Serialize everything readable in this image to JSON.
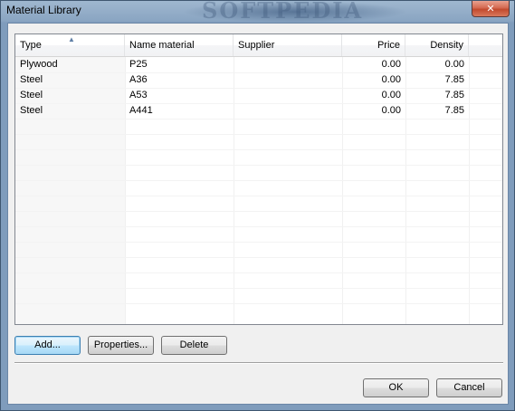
{
  "window": {
    "title": "Material Library",
    "close_glyph": "✕",
    "watermark": "SOFTPEDIA"
  },
  "grid": {
    "columns": [
      "Type",
      "Name material",
      "Supplier",
      "Price",
      "Density"
    ],
    "sort_glyph": "▲",
    "rows": [
      {
        "type": "Plywood",
        "name": "P25",
        "supplier": "",
        "price": "0.00",
        "density": "0.00"
      },
      {
        "type": "Steel",
        "name": "A36",
        "supplier": "",
        "price": "0.00",
        "density": "7.85"
      },
      {
        "type": "Steel",
        "name": "A53",
        "supplier": "",
        "price": "0.00",
        "density": "7.85"
      },
      {
        "type": "Steel",
        "name": "A441",
        "supplier": "",
        "price": "0.00",
        "density": "7.85"
      }
    ]
  },
  "buttons": {
    "add": "Add...",
    "properties": "Properties...",
    "delete": "Delete",
    "ok": "OK",
    "cancel": "Cancel"
  }
}
